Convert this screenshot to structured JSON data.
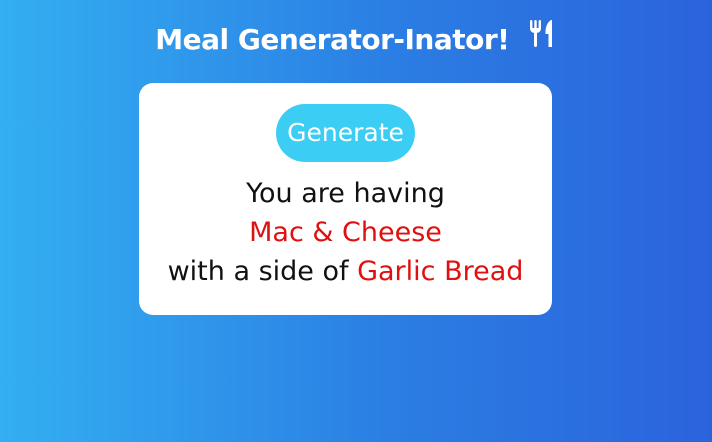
{
  "header": {
    "title": "Meal Generator-Inator!",
    "icon": "fork-and-knife-icon"
  },
  "card": {
    "generate_label": "Generate",
    "intro_text": "You are having",
    "main_dish": "Mac & Cheese",
    "side_prefix": "with a side of",
    "side_dish": "Garlic Bread"
  },
  "colors": {
    "background_start": "#33aff2",
    "background_end": "#2b63dc",
    "button": "#3ccdf4",
    "highlight": "#e01010"
  }
}
